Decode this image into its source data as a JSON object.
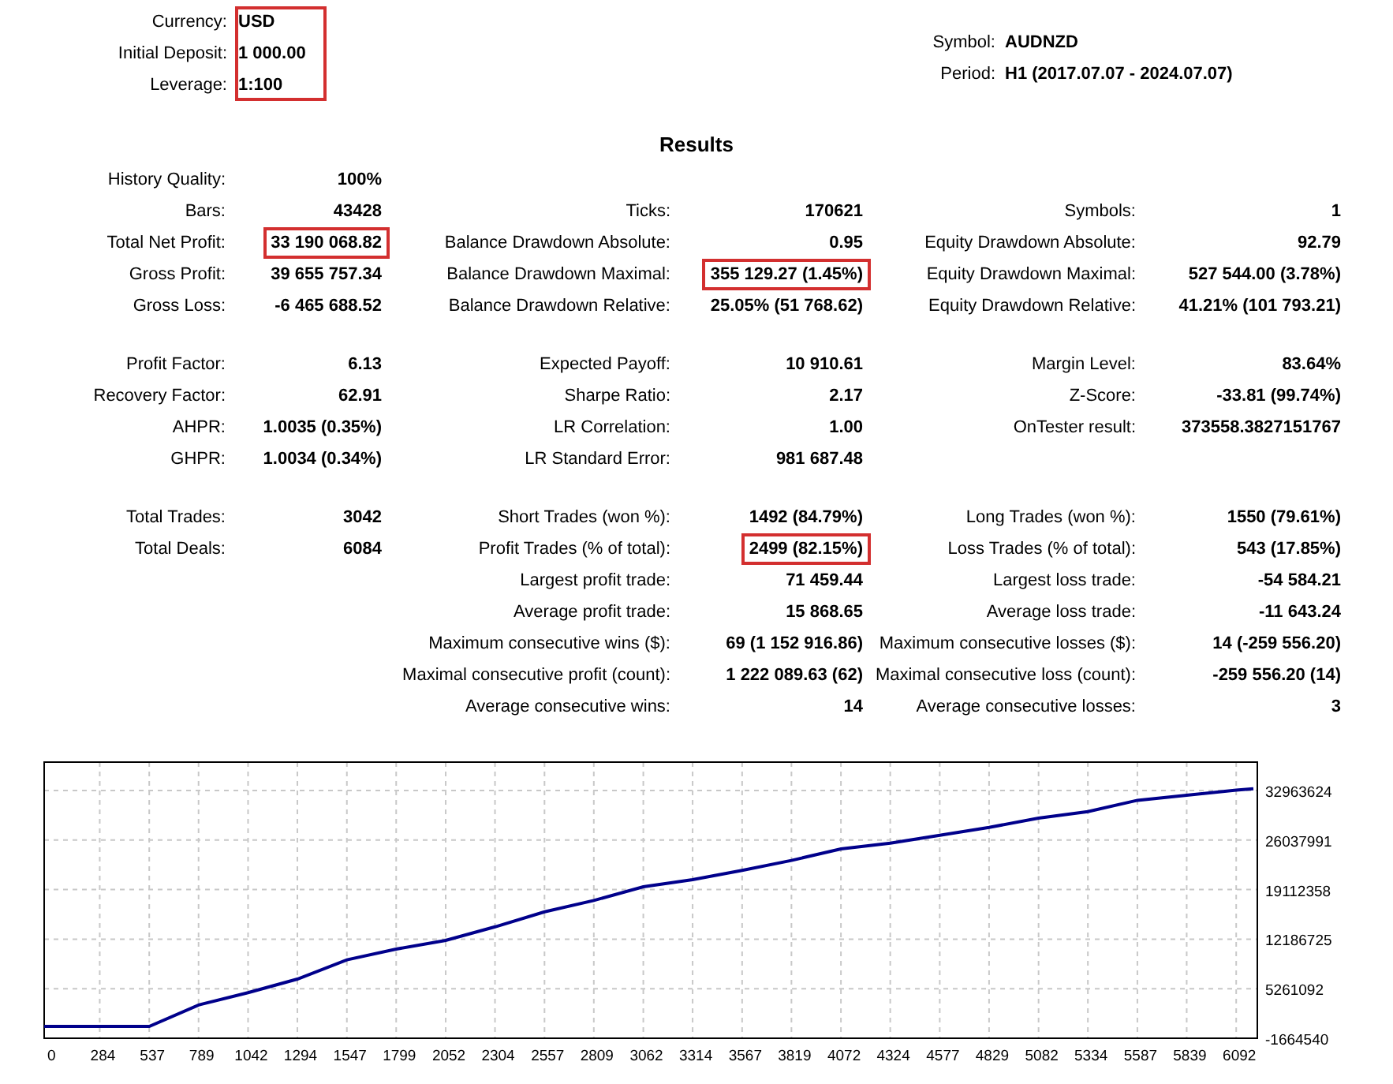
{
  "account": {
    "boxed": true,
    "fields": [
      {
        "label": "Currency:",
        "value": "USD"
      },
      {
        "label": "Initial Deposit:",
        "value": "1 000.00"
      },
      {
        "label": "Leverage:",
        "value": "1:100"
      }
    ]
  },
  "symbol_info": [
    {
      "label": "Symbol:",
      "value": "AUDNZD"
    },
    {
      "label": "Period:",
      "value": "H1 (2017.07.07 - 2024.07.07)"
    }
  ],
  "results_title": "Results",
  "stat_groups": [
    [
      {
        "col_1": {
          "label": "History Quality:",
          "value": "100%",
          "highlighted": false
        }
      },
      {
        "col_1": {
          "label": "Bars:",
          "value": "43428",
          "highlighted": false
        },
        "col_2": {
          "label": "Ticks:",
          "value": "170621",
          "highlighted": false
        },
        "col_3": {
          "label": "Symbols:",
          "value": "1",
          "highlighted": false
        }
      },
      {
        "col_1": {
          "label": "Total Net Profit:",
          "value": "33 190 068.82",
          "highlighted": true
        },
        "col_2": {
          "label": "Balance Drawdown Absolute:",
          "value": "0.95",
          "highlighted": false
        },
        "col_3": {
          "label": "Equity Drawdown Absolute:",
          "value": "92.79",
          "highlighted": false
        }
      },
      {
        "col_1": {
          "label": "Gross Profit:",
          "value": "39 655 757.34",
          "highlighted": false
        },
        "col_2": {
          "label": "Balance Drawdown Maximal:",
          "value": "355 129.27 (1.45%)",
          "highlighted": true
        },
        "col_3": {
          "label": "Equity Drawdown Maximal:",
          "value": "527 544.00 (3.78%)",
          "highlighted": false
        }
      },
      {
        "col_1": {
          "label": "Gross Loss:",
          "value": "-6 465 688.52",
          "highlighted": false
        },
        "col_2": {
          "label": "Balance Drawdown Relative:",
          "value": "25.05% (51 768.62)",
          "highlighted": false
        },
        "col_3": {
          "label": "Equity Drawdown Relative:",
          "value": "41.21% (101 793.21)",
          "highlighted": false
        }
      }
    ],
    [
      {
        "col_1": {
          "label": "Profit Factor:",
          "value": "6.13",
          "highlighted": false
        },
        "col_2": {
          "label": "Expected Payoff:",
          "value": "10 910.61",
          "highlighted": false
        },
        "col_3": {
          "label": "Margin Level:",
          "value": "83.64%",
          "highlighted": false
        }
      },
      {
        "col_1": {
          "label": "Recovery Factor:",
          "value": "62.91",
          "highlighted": false
        },
        "col_2": {
          "label": "Sharpe Ratio:",
          "value": "2.17",
          "highlighted": false
        },
        "col_3": {
          "label": "Z-Score:",
          "value": "-33.81 (99.74%)",
          "highlighted": false
        }
      },
      {
        "col_1": {
          "label": "AHPR:",
          "value": "1.0035 (0.35%)",
          "highlighted": false
        },
        "col_2": {
          "label": "LR Correlation:",
          "value": "1.00",
          "highlighted": false
        },
        "col_3": {
          "label": "OnTester result:",
          "value": "373558.3827151767",
          "highlighted": false
        }
      },
      {
        "col_1": {
          "label": "GHPR:",
          "value": "1.0034 (0.34%)",
          "highlighted": false
        },
        "col_2": {
          "label": "LR Standard Error:",
          "value": "981 687.48",
          "highlighted": false
        }
      }
    ],
    [
      {
        "col_1": {
          "label": "Total Trades:",
          "value": "3042",
          "highlighted": false
        },
        "col_2": {
          "label": "Short Trades (won %):",
          "value": "1492 (84.79%)",
          "highlighted": false
        },
        "col_3": {
          "label": "Long Trades (won %):",
          "value": "1550 (79.61%)",
          "highlighted": false
        }
      },
      {
        "col_1": {
          "label": "Total Deals:",
          "value": "6084",
          "highlighted": false
        },
        "col_2": {
          "label": "Profit Trades (% of total):",
          "value": "2499 (82.15%)",
          "highlighted": true
        },
        "col_3": {
          "label": "Loss Trades (% of total):",
          "value": "543 (17.85%)",
          "highlighted": false
        }
      },
      {
        "col_2": {
          "label": "Largest profit trade:",
          "value": "71 459.44",
          "highlighted": false
        },
        "col_3": {
          "label": "Largest loss trade:",
          "value": "-54 584.21",
          "highlighted": false
        }
      },
      {
        "col_2": {
          "label": "Average profit trade:",
          "value": "15 868.65",
          "highlighted": false
        },
        "col_3": {
          "label": "Average loss trade:",
          "value": "-11 643.24",
          "highlighted": false
        }
      },
      {
        "col_2": {
          "label": "Maximum consecutive wins ($):",
          "value": "69 (1 152 916.86)",
          "highlighted": false
        },
        "col_3": {
          "label": "Maximum consecutive losses ($):",
          "value": "14 (-259 556.20)",
          "highlighted": false
        }
      },
      {
        "col_2": {
          "label": "Maximal consecutive profit (count):",
          "value": "1 222 089.63 (62)",
          "highlighted": false
        },
        "col_3": {
          "label": "Maximal consecutive loss (count):",
          "value": "-259 556.20 (14)",
          "highlighted": false
        }
      },
      {
        "col_2": {
          "label": "Average consecutive wins:",
          "value": "14",
          "highlighted": false
        },
        "col_3": {
          "label": "Average consecutive losses:",
          "value": "3",
          "highlighted": false
        }
      }
    ]
  ],
  "balance_chart": {
    "chart_data": {
      "type": "line",
      "grid": true,
      "x": [
        0,
        284,
        537,
        789,
        1042,
        1294,
        1547,
        1799,
        2052,
        2304,
        2557,
        2809,
        3062,
        3314,
        3567,
        3819,
        4072,
        4324,
        4577,
        4829,
        5082,
        5334,
        5587,
        5839,
        6092,
        6180
      ],
      "series": [
        {
          "color": "#00008b",
          "values": [
            0,
            0,
            0,
            3000000,
            4700000,
            6600000,
            9300000,
            10800000,
            12000000,
            13900000,
            16000000,
            17600000,
            19500000,
            20500000,
            21800000,
            23200000,
            24800000,
            25600000,
            26700000,
            27800000,
            29100000,
            30000000,
            31600000,
            32300000,
            33000000,
            33200000
          ]
        }
      ],
      "xlim": [
        0,
        6200
      ],
      "ylim": [
        -1664540,
        36933600
      ],
      "xticks": [
        0,
        284,
        537,
        789,
        1042,
        1294,
        1547,
        1799,
        2052,
        2304,
        2557,
        2809,
        3062,
        3314,
        3567,
        3819,
        4072,
        4324,
        4577,
        4829,
        5082,
        5334,
        5587,
        5839,
        6092
      ],
      "yticks": [
        -1664540,
        5261092,
        12186725,
        19112358,
        26037991,
        32963624
      ]
    }
  }
}
